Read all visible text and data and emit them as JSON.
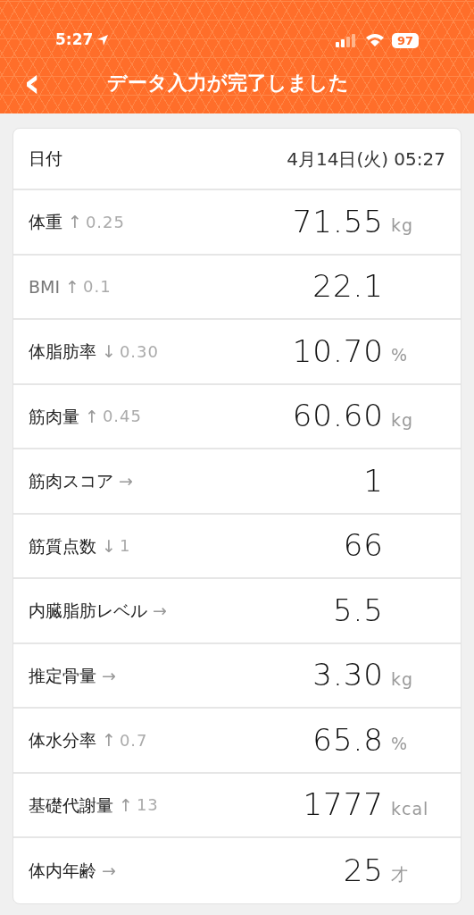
{
  "status_bar": {
    "time": "5:27",
    "battery": "97"
  },
  "nav": {
    "back": "‹",
    "title": "データ入力が完了しました"
  },
  "date_row": {
    "label": "日付",
    "value": "4月14日(火) 05:27"
  },
  "rows": [
    {
      "label": "体重",
      "muted": false,
      "trend": "↑",
      "delta": "0.25",
      "value": "71.55",
      "unit": "kg"
    },
    {
      "label": "BMI",
      "muted": true,
      "trend": "↑",
      "delta": "0.1",
      "value": "22.1"
    },
    {
      "label": "体脂肪率",
      "muted": false,
      "trend": "↓",
      "delta": "0.30",
      "value": "10.70",
      "unit": "%"
    },
    {
      "label": "筋肉量",
      "muted": false,
      "trend": "↑",
      "delta": "0.45",
      "value": "60.60",
      "unit": "kg"
    },
    {
      "label": "筋肉スコア",
      "muted": false,
      "trend": "→",
      "value": "1"
    },
    {
      "label": "筋質点数",
      "muted": false,
      "trend": "↓",
      "delta": "1",
      "value": "66"
    },
    {
      "label": "内臓脂肪レベル",
      "muted": false,
      "trend": "→",
      "value": "5.5"
    },
    {
      "label": "推定骨量",
      "muted": false,
      "trend": "→",
      "value": "3.30",
      "unit": "kg"
    },
    {
      "label": "体水分率",
      "muted": false,
      "trend": "↑",
      "delta": "0.7",
      "value": "65.8",
      "unit": "%"
    },
    {
      "label": "基礎代謝量",
      "muted": false,
      "trend": "↑",
      "delta": "13",
      "value": "1777",
      "unit": "kcal"
    },
    {
      "label": "体内年齢",
      "muted": false,
      "trend": "→",
      "value": "25",
      "unit": "才"
    }
  ]
}
